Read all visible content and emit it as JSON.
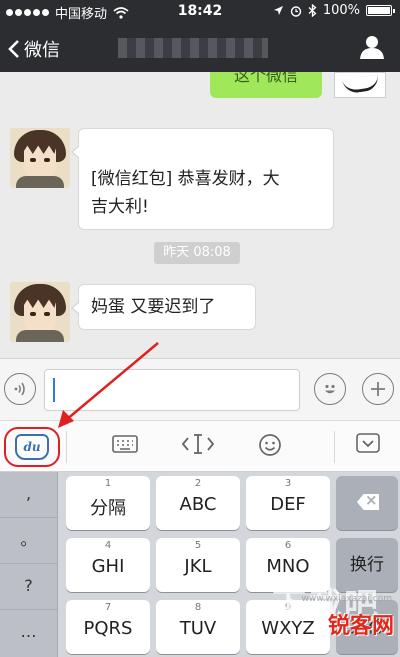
{
  "status_bar": {
    "carrier": "中国移动",
    "time": "18:42",
    "battery": "100%",
    "battery_level": 1.0
  },
  "nav": {
    "back_label": "微信"
  },
  "chat": {
    "sent_message": "这个微信",
    "messages": [
      {
        "text": "[微信红包] 恭喜发财，大\n吉大利!"
      },
      {
        "text": "妈蛋  又要迟到了"
      }
    ],
    "timestamp": "昨天 08:08"
  },
  "keyboard": {
    "side_keys": [
      ",",
      "。",
      "?",
      "…"
    ],
    "keys": [
      {
        "num": "1",
        "label": "分隔"
      },
      {
        "num": "2",
        "label": "ABC"
      },
      {
        "num": "3",
        "label": "DEF"
      },
      {
        "num": "4",
        "label": "GHI"
      },
      {
        "num": "5",
        "label": "JKL"
      },
      {
        "num": "6",
        "label": "MNO"
      },
      {
        "num": "7",
        "label": "PQRS"
      },
      {
        "num": "8",
        "label": "TUV"
      },
      {
        "num": "9",
        "label": "WXYZ"
      }
    ],
    "return_label": "换行",
    "return_label_2": "换行"
  },
  "watermark": {
    "text": "锐客网",
    "url": "www.wxiaxazai.com",
    "big": "下载吧"
  },
  "colors": {
    "annotation": "#e02020",
    "bubble_green": "#a0e75a",
    "topbar": "#2b2d31"
  }
}
